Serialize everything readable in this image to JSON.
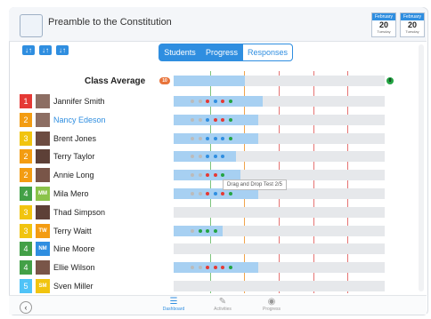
{
  "header": {
    "title": "Preamble to the Constitution",
    "dates": [
      {
        "label": "February",
        "num": "20",
        "sub": "Tuesday"
      },
      {
        "label": "February",
        "num": "20",
        "sub": "Tuesday"
      }
    ]
  },
  "tabs": [
    {
      "label": "Students",
      "active": true
    },
    {
      "label": "Progress",
      "active": true
    },
    {
      "label": "Responses",
      "active": false
    }
  ],
  "sort_buttons": [
    "↓↑",
    "↓↑",
    "↓↑"
  ],
  "class_average": {
    "label": "Class Average",
    "left_badge": "10",
    "right_badge": "0"
  },
  "tooltip": "Drag and Drop Test 2/5",
  "students": [
    {
      "rank": "1",
      "rank_color": "#e53935",
      "initials": "",
      "avatar_color": "#8d6e63",
      "name": "Jannifer Smith",
      "highlight": false,
      "dots": [
        "#bbb",
        "#bbb",
        "#e53935",
        "#2f8ee0",
        "#e53935",
        "#23a443"
      ]
    },
    {
      "rank": "2",
      "rank_color": "#f39c12",
      "initials": "",
      "avatar_color": "#8d6e63",
      "name": "Nancy Edeson",
      "highlight": true,
      "dots": [
        "#bbb",
        "#bbb",
        "#2f8ee0",
        "#e53935",
        "#e53935",
        "#23a443"
      ]
    },
    {
      "rank": "3",
      "rank_color": "#f1c40f",
      "initials": "",
      "avatar_color": "#6d4c41",
      "name": "Brent Jones",
      "highlight": false,
      "dots": [
        "#bbb",
        "#bbb",
        "#2f8ee0",
        "#2f8ee0",
        "#2f8ee0",
        "#23a443"
      ]
    },
    {
      "rank": "2",
      "rank_color": "#f39c12",
      "initials": "",
      "avatar_color": "#5d4037",
      "name": "Terry Taylor",
      "highlight": false,
      "dots": [
        "#bbb",
        "#bbb",
        "#2f8ee0",
        "#2f8ee0",
        "#2f8ee0"
      ]
    },
    {
      "rank": "2",
      "rank_color": "#f39c12",
      "initials": "",
      "avatar_color": "#795548",
      "name": "Annie Long",
      "highlight": false,
      "dots": [
        "#bbb",
        "#bbb",
        "#e53935",
        "#e53935",
        "#23a443"
      ]
    },
    {
      "rank": "4",
      "rank_color": "#43a047",
      "initials": "MM",
      "avatar_color": "#8bc34a",
      "name": "Mila Mero",
      "highlight": false,
      "dots": [
        "#bbb",
        "#bbb",
        "#e53935",
        "#2f8ee0",
        "#e53935",
        "#23a443"
      ]
    },
    {
      "rank": "3",
      "rank_color": "#f1c40f",
      "initials": "",
      "avatar_color": "#5d4037",
      "name": "Thad Simpson",
      "highlight": false,
      "dots": []
    },
    {
      "rank": "3",
      "rank_color": "#f1c40f",
      "initials": "TW",
      "avatar_color": "#f39c12",
      "name": "Terry Waitt",
      "highlight": false,
      "dots": [
        "#bbb",
        "#23a443",
        "#23a443",
        "#23a443"
      ]
    },
    {
      "rank": "4",
      "rank_color": "#43a047",
      "initials": "NM",
      "avatar_color": "#2f8ee0",
      "name": "Nine Moore",
      "highlight": false,
      "dots": []
    },
    {
      "rank": "4",
      "rank_color": "#43a047",
      "initials": "",
      "avatar_color": "#795548",
      "name": "Ellie Wilson",
      "highlight": false,
      "dots": [
        "#bbb",
        "#bbb",
        "#e53935",
        "#e53935",
        "#e53935",
        "#23a443"
      ]
    },
    {
      "rank": "5",
      "rank_color": "#4fc3f7",
      "initials": "SM",
      "avatar_color": "#f1c40f",
      "name": "Sven Miller",
      "highlight": false,
      "dots": []
    }
  ],
  "footer": {
    "items": [
      {
        "label": "Dashboard",
        "active": true
      },
      {
        "label": "Activities",
        "active": false
      },
      {
        "label": "Progress",
        "active": false
      }
    ]
  }
}
